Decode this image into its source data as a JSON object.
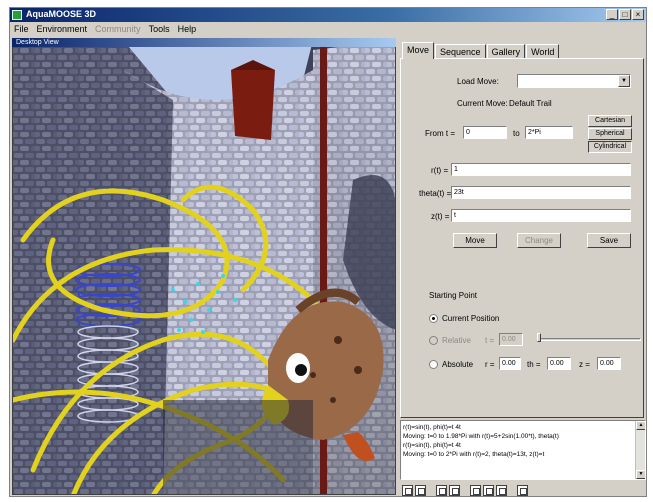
{
  "window": {
    "title": "AquaMOOSE 3D"
  },
  "menu": [
    {
      "label": "File",
      "enabled": true
    },
    {
      "label": "Environment",
      "enabled": true
    },
    {
      "label": "Community",
      "enabled": false
    },
    {
      "label": "Tools",
      "enabled": true
    },
    {
      "label": "Help",
      "enabled": true
    }
  ],
  "viewport": {
    "label": "Desktop View"
  },
  "tabs": [
    "Move",
    "Sequence",
    "Gallery",
    "World"
  ],
  "move_panel": {
    "load_move_label": "Load Move:",
    "load_move_value": "",
    "current_move_label": "Current Move:",
    "current_move_value": "Default Trail",
    "from_label": "From t =",
    "from_value": "0",
    "to_label": "to",
    "to_value": "2*Pi",
    "coord_buttons": [
      "Cartesian",
      "Spherical",
      "Cylindrical"
    ],
    "r_label": "r(t) =",
    "r_value": "1",
    "theta_label": "theta(t) =",
    "theta_value": "23t",
    "z_label": "z(t) =",
    "z_value": "t",
    "move_button": "Move",
    "change_button": "Change",
    "save_button": "Save",
    "starting_point_label": "Starting Point",
    "current_position_label": "Current Position",
    "relative_label": "Relative",
    "relative_t_label": "t =",
    "relative_t_value": "0.00",
    "absolute_label": "Absolute",
    "abs_r_label": "r =",
    "abs_r_value": "0.00",
    "abs_th_label": "th =",
    "abs_th_value": "0.00",
    "abs_z_label": "z =",
    "abs_z_value": "0.00"
  },
  "console": {
    "lines": [
      "r(t)=sin(t), phi(t)=t 4t",
      "Moving: t=0 to 1.98*Pi with r(t)=5+2sin(1.00*t), theta(t)",
      "r(t)=sin(t), phi(t)=t 4t",
      "Moving: t=0 to 2*Pi with r(t)=2, theta(t)=13t, z(t)=t"
    ]
  },
  "colors": {
    "titlebar": "#0a246a",
    "panel": "#d4d0c8",
    "trail": "#e2d21e",
    "spring": "#3a46c8"
  }
}
